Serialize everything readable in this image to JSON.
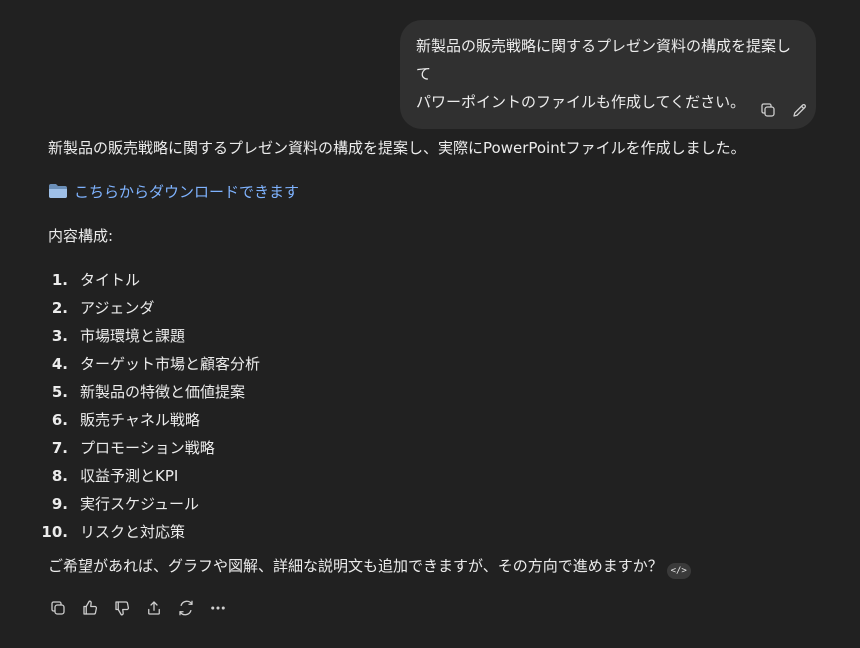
{
  "user_message": {
    "text": "新製品の販売戦略に関するプレゼン資料の構成を提案して\nパワーポイントのファイルも作成してください。"
  },
  "user_actions": {
    "icons": [
      "copy-icon",
      "edit-icon"
    ]
  },
  "assistant": {
    "intro": "新製品の販売戦略に関するプレゼン資料の構成を提案し、実際にPowerPointファイルを作成しました。",
    "download_link": "こちらからダウンロードできます",
    "contents_heading": "内容構成:",
    "items": [
      {
        "num": "1.",
        "label": "タイトル"
      },
      {
        "num": "2.",
        "label": "アジェンダ"
      },
      {
        "num": "3.",
        "label": "市場環境と課題"
      },
      {
        "num": "4.",
        "label": "ターゲット市場と顧客分析"
      },
      {
        "num": "5.",
        "label": "新製品の特徴と価値提案"
      },
      {
        "num": "6.",
        "label": "販売チャネル戦略"
      },
      {
        "num": "7.",
        "label": "プロモーション戦略"
      },
      {
        "num": "8.",
        "label": "収益予測とKPI"
      },
      {
        "num": "9.",
        "label": "実行スケジュール"
      },
      {
        "num": "10.",
        "label": "リスクと対応策"
      }
    ],
    "closing": "ご希望があれば、グラフや図解、詳細な説明文も追加できますが、その方向で進めますか？",
    "code_badge": "</>"
  },
  "colors": {
    "background": "#212121",
    "bubble": "#303030",
    "link": "#7fb3ff",
    "text": "#ececec"
  },
  "bottom_actions": {
    "icons": [
      "copy-icon",
      "thumbs-up-icon",
      "thumbs-down-icon",
      "share-icon",
      "regenerate-icon",
      "more-icon"
    ]
  }
}
